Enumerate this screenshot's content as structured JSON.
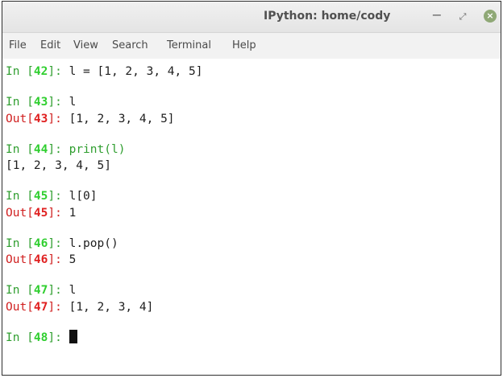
{
  "window": {
    "title": "IPython: home/cody",
    "controls": {
      "minimize": "−",
      "maximize": "⤢",
      "close": "×"
    }
  },
  "menu": [
    "File",
    "Edit",
    "View",
    "Search",
    "Terminal",
    "Help"
  ],
  "session": [
    {
      "n": "42",
      "input": "l = [1, 2, 3, 4, 5]"
    },
    {
      "n": "43",
      "input": "l",
      "out": "[1, 2, 3, 4, 5]"
    },
    {
      "n": "44",
      "input": "print(l)",
      "stdout": "[1, 2, 3, 4, 5]"
    },
    {
      "n": "45",
      "input": "l[0]",
      "out": "1"
    },
    {
      "n": "46",
      "input": "l.pop()",
      "out": "5"
    },
    {
      "n": "47",
      "input": "l",
      "out": "[1, 2, 3, 4]"
    },
    {
      "n": "48",
      "input": ""
    }
  ],
  "colors": {
    "prompt_in": "#2f9e2f",
    "prompt_in_number": "#2fcf2f",
    "prompt_out": "#d02020",
    "close_button": "#8fa876"
  }
}
